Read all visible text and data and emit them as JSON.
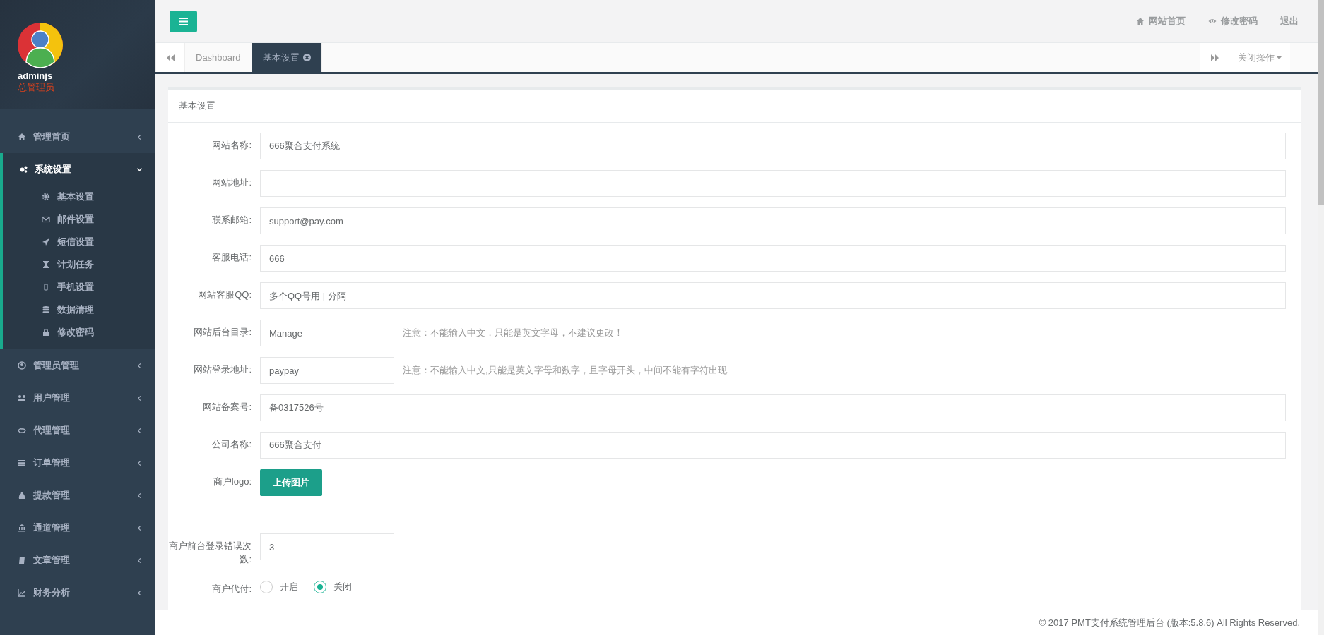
{
  "sidebar": {
    "user": {
      "name": "adminjs",
      "role": "总管理员"
    },
    "menu": [
      {
        "label": "管理首页",
        "expanded": false
      },
      {
        "label": "系统设置",
        "expanded": true,
        "children": [
          {
            "label": "基本设置"
          },
          {
            "label": "邮件设置"
          },
          {
            "label": "短信设置"
          },
          {
            "label": "计划任务"
          },
          {
            "label": "手机设置"
          },
          {
            "label": "数据清理"
          },
          {
            "label": "修改密码"
          }
        ]
      },
      {
        "label": "管理员管理",
        "expanded": false
      },
      {
        "label": "用户管理",
        "expanded": false
      },
      {
        "label": "代理管理",
        "expanded": false
      },
      {
        "label": "订单管理",
        "expanded": false
      },
      {
        "label": "提款管理",
        "expanded": false
      },
      {
        "label": "通道管理",
        "expanded": false
      },
      {
        "label": "文章管理",
        "expanded": false
      },
      {
        "label": "财务分析",
        "expanded": false
      }
    ]
  },
  "topbar": {
    "links": [
      "网站首页",
      "修改密码",
      "退出"
    ]
  },
  "tabs": [
    {
      "label": "Dashboard",
      "selected": false,
      "closable": false
    },
    {
      "label": "基本设置",
      "selected": true,
      "closable": true
    }
  ],
  "close_menu": "关闭操作",
  "panel": {
    "title": "基本设置",
    "fields": [
      {
        "kind": "text",
        "label": "网站名称:",
        "value": "666聚合支付系统"
      },
      {
        "kind": "text",
        "label": "网站地址:"
      },
      {
        "kind": "text",
        "label": "联系邮箱:",
        "value": "support@pay.com"
      },
      {
        "kind": "text",
        "label": "客服电话:",
        "value": "666"
      },
      {
        "kind": "text",
        "label": "网站客服QQ:",
        "placeholder": "多个QQ号用 | 分隔"
      },
      {
        "kind": "short",
        "label": "网站后台目录:",
        "value": "Manage",
        "note": "注意：不能输入中文，只能是英文字母，不建议更改！"
      },
      {
        "kind": "short",
        "label": "网站登录地址:",
        "value": "paypay",
        "note": "注意：不能输入中文,只能是英文字母和数字，且字母开头，中间不能有字符出现."
      },
      {
        "kind": "text",
        "label": "网站备案号:",
        "value": "备0317526号"
      },
      {
        "kind": "text",
        "label": "公司名称:",
        "value": "666聚合支付"
      },
      {
        "kind": "upload",
        "label": "商户logo:",
        "button": "上传图片"
      },
      {
        "kind": "short",
        "label": "商户前台登录错误次数:",
        "value": "3"
      },
      {
        "kind": "radio",
        "label": "商户代付:",
        "options": [
          {
            "label": "开启",
            "selected": false
          },
          {
            "label": "关闭",
            "selected": true
          }
        ]
      }
    ]
  },
  "footer": "© 2017 PMT支付系统管理后台 (版本:5.8.6) All Rights Reserved."
}
